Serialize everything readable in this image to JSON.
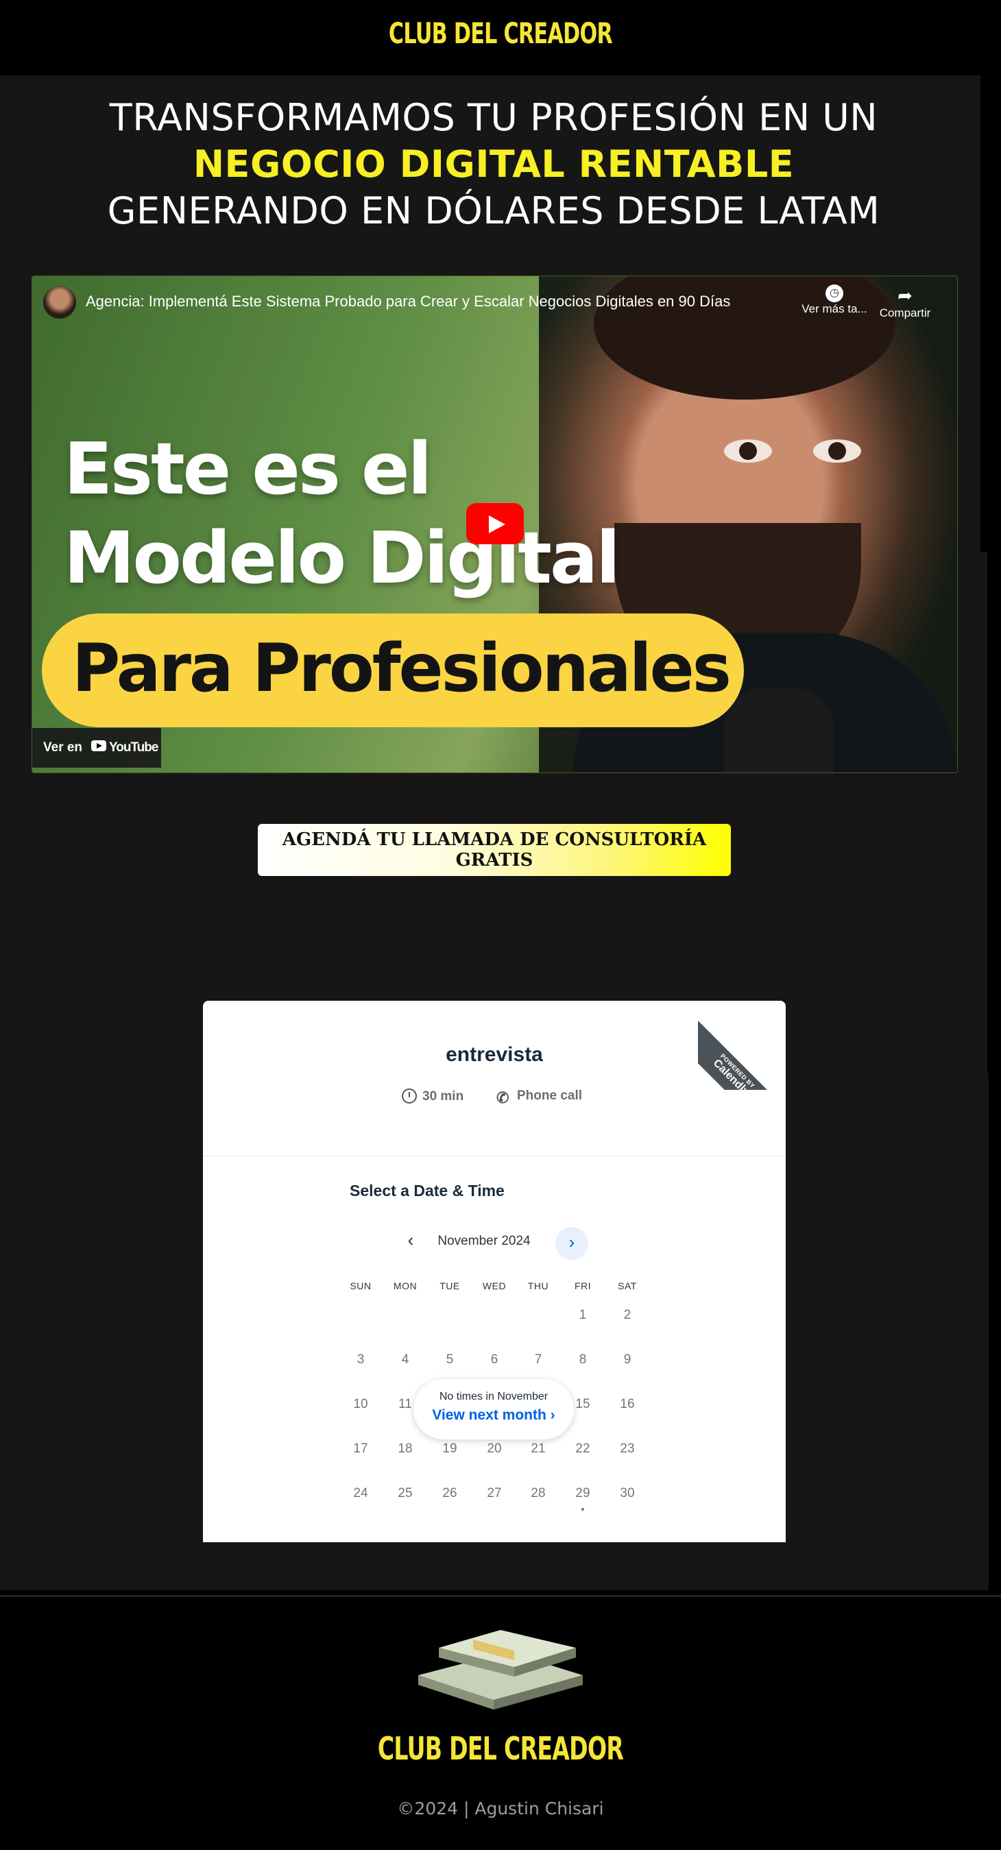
{
  "brand": {
    "logo_text": "CLUB DEL CREADOR",
    "accent_color": "#f7f025"
  },
  "hero": {
    "line1": "TRANSFORMAMOS TU PROFESIÓN EN UN",
    "line2": "NEGOCIO DIGITAL RENTABLE",
    "line3": "GENERANDO EN DÓLARES DESDE LATAM"
  },
  "video": {
    "title": "Agencia: Implementá Este Sistema Probado para Crear y Escalar Negocios Digitales en 90 Días",
    "watch_later": "Ver más ta...",
    "share": "Compartir",
    "thumb_line1": "Este es el",
    "thumb_line2": "Modelo Digital",
    "thumb_pill": "Para Profesionales",
    "watch_on": "Ver en",
    "watch_brand": "YouTube"
  },
  "cta": {
    "label": "AGENDÁ TU LLAMADA DE CONSULTORÍA GRATIS"
  },
  "calendly": {
    "ribbon_powered": "POWERED BY",
    "ribbon_brand": "Calendly",
    "event_name": "entrevista",
    "duration": "30 min",
    "location": "Phone call",
    "select_title": "Select a Date & Time",
    "month": "November 2024",
    "weekdays": [
      "SUN",
      "MON",
      "TUE",
      "WED",
      "THU",
      "FRI",
      "SAT"
    ],
    "weeks": [
      [
        "",
        "",
        "",
        "",
        "",
        "1",
        "2"
      ],
      [
        "3",
        "4",
        "5",
        "6",
        "7",
        "8",
        "9"
      ],
      [
        "10",
        "11",
        "",
        "",
        "",
        "15",
        "16"
      ],
      [
        "17",
        "18",
        "19",
        "20",
        "21",
        "22",
        "23"
      ],
      [
        "24",
        "25",
        "26",
        "27",
        "28",
        "29",
        "30"
      ]
    ],
    "notice_text": "No times in November",
    "notice_button": "View next month"
  },
  "footer": {
    "logo_text": "CLUB DEL CREADOR",
    "copyright": "©2024 | Agustin Chisari"
  }
}
